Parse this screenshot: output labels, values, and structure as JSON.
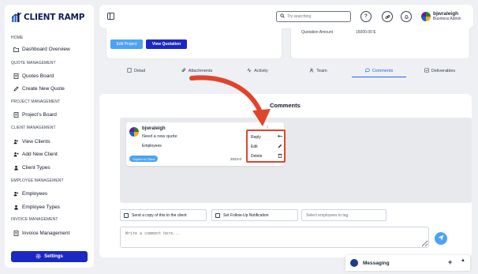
{
  "app": {
    "logo_text": "CLIENT RAMP"
  },
  "sidebar": {
    "sections": [
      {
        "title": "HOME",
        "items": [
          {
            "label": "Dashboard Overview",
            "icon": "folder-icon"
          }
        ]
      },
      {
        "title": "QUOTE MANAGEMENT",
        "items": [
          {
            "label": "Quotes Board",
            "icon": "document-icon"
          },
          {
            "label": "Create New Quote",
            "icon": "edit-icon"
          }
        ]
      },
      {
        "title": "PROJECT MANAGEMENT",
        "items": [
          {
            "label": "Project's Board",
            "icon": "document-icon"
          }
        ]
      },
      {
        "title": "CLIENT MANAGEMENT",
        "items": [
          {
            "label": "View Clients",
            "icon": "users-icon"
          },
          {
            "label": "Add New Client",
            "icon": "user-plus-icon"
          },
          {
            "label": "Client Types",
            "icon": "user-icon"
          }
        ]
      },
      {
        "title": "EMPLOYEE MANAGEMENT",
        "items": [
          {
            "label": "Employees",
            "icon": "users-icon"
          },
          {
            "label": "Employee Types",
            "icon": "user-icon"
          }
        ]
      },
      {
        "title": "INVOICE MANAGEMENT",
        "items": [
          {
            "label": "Invoice Management",
            "icon": "document-icon"
          }
        ]
      }
    ],
    "settings_label": "Settings"
  },
  "header": {
    "search_placeholder": "Try searching",
    "user_name": "bjwraleigh",
    "user_role": "Business Admin"
  },
  "project": {
    "edit_label": "Edit Project",
    "view_quotation_label": "View Quotation",
    "quotation_amount_label": "Quotation Amount",
    "quotation_amount_value": "15000.00 $"
  },
  "tabs": [
    {
      "label": "Detail",
      "icon": "detail-icon",
      "active": false
    },
    {
      "label": "Attachments",
      "icon": "paperclip-icon",
      "active": false
    },
    {
      "label": "Activity",
      "icon": "activity-icon",
      "active": false
    },
    {
      "label": "Team",
      "icon": "team-icon",
      "active": false
    },
    {
      "label": "Comments",
      "icon": "comment-icon",
      "active": true
    },
    {
      "label": "Deliverables",
      "icon": "deliverables-icon",
      "active": false
    }
  ],
  "comments": {
    "title": "Comments",
    "items": [
      {
        "author": "bjwraleigh",
        "text": "Need a new quote",
        "tag": "Employees",
        "copied_label": "Copied to Client",
        "date": "2023-0"
      }
    ],
    "menu": {
      "reply": "Reply",
      "edit": "Edit",
      "delete": "Delete"
    },
    "send_copy_label": "Send a copy of this to the client",
    "followup_label": "Set Follow-Up Notification",
    "tag_placeholder": "Select employees to tag",
    "input_placeholder": "Write a comment here..."
  },
  "messaging": {
    "label": "Messaging"
  },
  "colors": {
    "primary": "#1b28c4",
    "accent": "#4ba3f5",
    "highlight": "#e0452b",
    "active_tab": "#2563eb"
  }
}
